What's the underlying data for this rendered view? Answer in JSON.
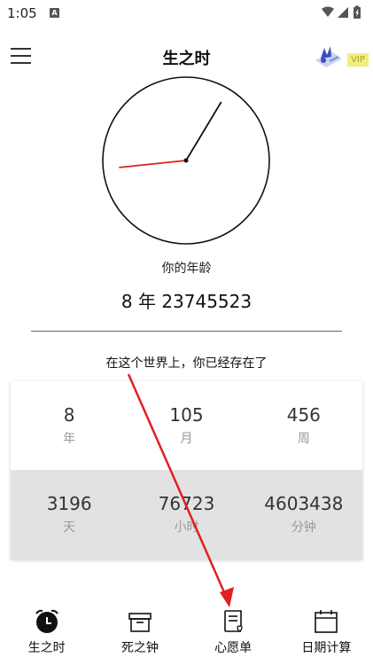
{
  "status_bar": {
    "time": "1:05",
    "notification_icon": "A"
  },
  "header": {
    "title": "生之时",
    "vip_label": "VIP"
  },
  "clock": {
    "hour_hand_angle_deg": 31,
    "minute_hand_angle_deg": 264,
    "minute_hand_color": "#e02020"
  },
  "age": {
    "label": "你的年龄",
    "value": "8 年 23745523"
  },
  "exist_label": "在这个世界上，你已经存在了",
  "stats": {
    "top": [
      {
        "value": "8",
        "unit": "年"
      },
      {
        "value": "105",
        "unit": "月"
      },
      {
        "value": "456",
        "unit": "周"
      }
    ],
    "bottom": [
      {
        "value": "3196",
        "unit": "天"
      },
      {
        "value": "76723",
        "unit": "小时"
      },
      {
        "value": "4603438",
        "unit": "分钟"
      }
    ]
  },
  "nav": [
    {
      "label": "生之时",
      "icon": "alarm-clock-icon"
    },
    {
      "label": "死之钟",
      "icon": "archive-box-icon"
    },
    {
      "label": "心愿单",
      "icon": "wishlist-note-icon"
    },
    {
      "label": "日期计算",
      "icon": "calendar-icon"
    }
  ],
  "colors": {
    "accent_red": "#e02020",
    "vip_yellow": "#f3ed7c"
  }
}
